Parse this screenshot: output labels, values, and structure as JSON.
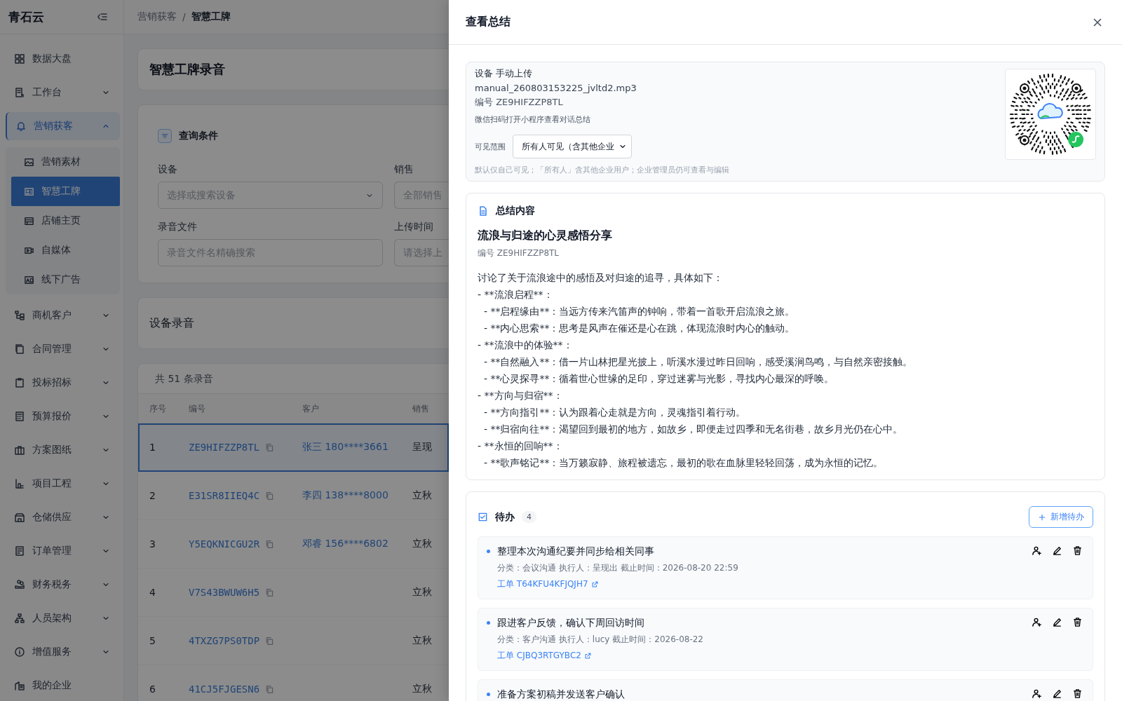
{
  "app": {
    "logo": "青石云"
  },
  "sidebar": {
    "items": [
      {
        "label": "数据大盘",
        "kind": "link"
      },
      {
        "label": "工作台",
        "kind": "group",
        "expanded": false
      },
      {
        "label": "营销获客",
        "kind": "group",
        "expanded": true,
        "children": [
          {
            "label": "营销素材",
            "selected": false
          },
          {
            "label": "智慧工牌",
            "selected": true
          },
          {
            "label": "店铺主页",
            "selected": false
          },
          {
            "label": "自媒体",
            "selected": false
          },
          {
            "label": "线下广告",
            "selected": false
          }
        ]
      },
      {
        "label": "商机客户",
        "kind": "group",
        "expanded": false
      },
      {
        "label": "合同管理",
        "kind": "group",
        "expanded": false
      },
      {
        "label": "投标招标",
        "kind": "group",
        "expanded": false
      },
      {
        "label": "预算报价",
        "kind": "group",
        "expanded": false
      },
      {
        "label": "方案图纸",
        "kind": "group",
        "expanded": false
      },
      {
        "label": "项目工程",
        "kind": "group",
        "expanded": false
      },
      {
        "label": "仓储供应",
        "kind": "group",
        "expanded": false
      },
      {
        "label": "订单管理",
        "kind": "group",
        "expanded": false
      },
      {
        "label": "财务税务",
        "kind": "group",
        "expanded": false
      },
      {
        "label": "人员架构",
        "kind": "group",
        "expanded": false
      },
      {
        "label": "增值服务",
        "kind": "group",
        "expanded": false
      },
      {
        "label": "我的企业",
        "kind": "link"
      }
    ]
  },
  "breadcrumb": [
    "营销获客",
    "智慧工牌"
  ],
  "breadcrumb_separator": "/",
  "page_title": "智慧工牌录音",
  "query": {
    "title": "查询条件",
    "fields": [
      {
        "label": "设备",
        "placeholder": "选择或搜索设备",
        "kind": "select"
      },
      {
        "label": "销售",
        "placeholder": "全部销售",
        "kind": "input"
      },
      {
        "label": "录音文件",
        "placeholder": "录音文件名精确搜索",
        "kind": "input"
      },
      {
        "label": "上传时间",
        "placeholder": "请选择上",
        "kind": "input"
      }
    ]
  },
  "records_title": "设备录音",
  "table": {
    "total": "共 51 条录音",
    "columns": [
      "序号",
      "编号",
      "客户",
      "销售"
    ],
    "rows": [
      {
        "index": "1",
        "code": "ZE9HIFZZP8TL",
        "customer": "张三 180****3661",
        "sales": "呈现",
        "selected": true
      },
      {
        "index": "2",
        "code": "E31SR8IIEQ4C",
        "customer": "李四 138****8000",
        "sales": "立秋",
        "selected": false
      },
      {
        "index": "3",
        "code": "Y5EQKNICGU2R",
        "customer": "邓睿 156****6802",
        "sales": "立秋",
        "selected": false
      },
      {
        "index": "4",
        "code": "V7S43BWUW6H5",
        "sales": "立秋",
        "selected": false
      },
      {
        "index": "5",
        "code": "4TXZG7PS0TDP",
        "sales": "立秋",
        "selected": false
      },
      {
        "index": "6",
        "code": "41CJ5FJGESN6",
        "sales": "立秋",
        "selected": false
      }
    ]
  },
  "drawer": {
    "title": "查看总结",
    "info": {
      "device": "设备 手动上传",
      "file": "manual_260803153225_jvltd2.mp3",
      "code": "编号 ZE9HIFZZP8TL",
      "hint": "微信扫码打开小程序查看对话总结",
      "visibility_label": "可见范围",
      "visibility_value": "所有人可见（含其他企业",
      "visibility_note": "默认仅自己可见；「所有人」含其他企业用户；企业管理员仍可查看与编辑"
    },
    "summary": {
      "heading": "总结内容",
      "title": "流浪与归途的心灵感悟分享",
      "code": "编号 ZE9HIFZZP8TL",
      "lines": [
        "讨论了关于流浪途中的感悟及对归途的追寻，具体如下：",
        "- **流浪启程**：",
        "  - **启程缘由**：当远方传来汽笛声的钟响，带着一首歌开启流浪之旅。",
        "  - **内心思索**：思考是风声在催还是心在跳，体现流浪时内心的触动。",
        "- **流浪中的体验**：",
        "  - **自然融入**：借一片山林把星光披上，听溪水漫过昨日回响，感受溪涧鸟鸣，与自然亲密接触。",
        "  - **心灵探寻**：循着世心世缘的足印，穿过迷雾与光影，寻找内心最深的呼唤。",
        "- **方向与归宿**：",
        "  - **方向指引**：认为跟着心走就是方向，灵魂指引着行动。",
        "  - **归宿向往**：渴望回到最初的地方，如故乡，即便走过四季和无名街巷，故乡月光仍在心中。",
        "- **永恒的回响**：",
        "  - **歌声铭记**：当万籁寂静、旅程被遗忘，最初的歌在血脉里轻轻回荡，成为永恒的记忆。"
      ]
    },
    "todos": {
      "title": "待办",
      "count": "4",
      "add_label": "新增待办",
      "items": [
        {
          "title": "整理本次沟通纪要并同步给相关同事",
          "meta": "分类：会议沟通 执行人：呈现出 截止时间：2026-08-20 22:59",
          "ticket": "工单 T64KFU4KFJQJH7"
        },
        {
          "title": "跟进客户反馈，确认下周回访时间",
          "meta": "分类：客户沟通 执行人：lucy 截止时间：2026-08-22",
          "ticket": "工单 CJBQ3RTGYBC2"
        },
        {
          "title": "准备方案初稿并发送客户确认"
        }
      ]
    }
  }
}
